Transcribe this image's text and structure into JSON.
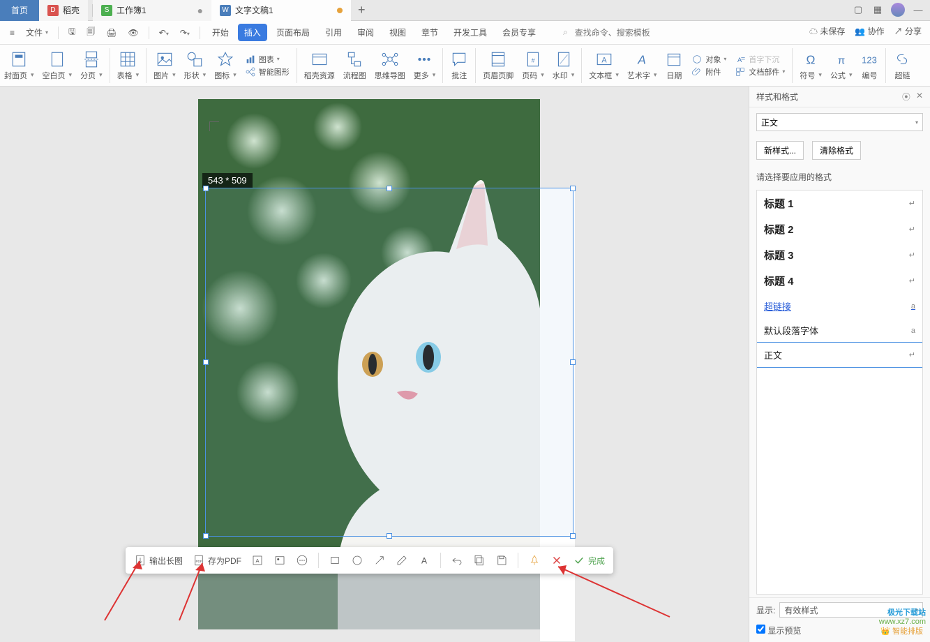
{
  "tabs": {
    "home": "首页",
    "dacell": "稻壳",
    "workbook": "工作簿1",
    "doc": "文字文稿1"
  },
  "menubar": {
    "file": "文件",
    "items": [
      "开始",
      "插入",
      "页面布局",
      "引用",
      "审阅",
      "视图",
      "章节",
      "开发工具",
      "会员专享"
    ],
    "active": "插入",
    "search_placeholder": "查找命令、搜索模板",
    "right": {
      "unsaved": "未保存",
      "coop": "协作",
      "share": "分享"
    }
  },
  "ribbon": {
    "groups": [
      "封面页",
      "空白页",
      "分页",
      "表格",
      "图片",
      "形状",
      "图标"
    ],
    "chart": "图表",
    "smartart": "智能图形",
    "resource": "稻壳资源",
    "flowchart": "流程图",
    "mindmap": "思维导图",
    "more": "更多",
    "comment": "批注",
    "headerfooter": "页眉页脚",
    "pagenum": "页码",
    "watermark": "水印",
    "textbox": "文本框",
    "wordart": "艺术字",
    "date": "日期",
    "object": "对象",
    "dropcap": "首字下沉",
    "attachment": "附件",
    "docparts": "文档部件",
    "symbol": "符号",
    "formula": "公式",
    "number": "编号",
    "hyperlink": "超链"
  },
  "selection_size": "543 * 509",
  "shotbar": {
    "export_long": "输出长图",
    "save_pdf": "存为PDF",
    "done": "完成"
  },
  "sidepanel": {
    "title": "样式和格式",
    "current": "正文",
    "new_style": "新样式...",
    "clear_format": "清除格式",
    "choose_label": "请选择要应用的格式",
    "styles": [
      {
        "label": "标题 1",
        "mark": "↵"
      },
      {
        "label": "标题 2",
        "mark": "↵"
      },
      {
        "label": "标题 3",
        "mark": "↵"
      },
      {
        "label": "标题 4",
        "mark": "↵"
      },
      {
        "label": "超链接",
        "mark": "a",
        "kind": "link"
      },
      {
        "label": "默认段落字体",
        "mark": "a",
        "kind": "normal"
      },
      {
        "label": "正文",
        "mark": "↵",
        "kind": "selected"
      }
    ],
    "show_label": "显示:",
    "show_value": "有效样式",
    "preview": "显示预览",
    "smart_layout": "智能排版",
    "watermark1": "极光下载站",
    "watermark2": "www.xz7.com"
  }
}
